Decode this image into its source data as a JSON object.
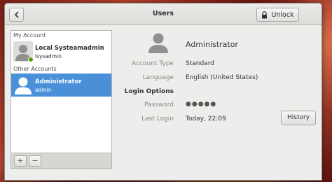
{
  "window": {
    "title": "Users"
  },
  "header": {
    "back_icon": "chevron-left-icon",
    "unlock_label": "Unlock",
    "unlock_icon": "lock-icon"
  },
  "sidebar": {
    "my_account_label": "My Account",
    "other_accounts_label": "Other Accounts",
    "accounts": [
      {
        "name": "Local Systeamadmin",
        "login": "lsysadmin",
        "online": true,
        "selected": false
      },
      {
        "name": "Administrator",
        "login": "admin",
        "online": false,
        "selected": true
      }
    ],
    "add_label": "+",
    "remove_label": "−"
  },
  "details": {
    "user_name": "Administrator",
    "account_type_label": "Account Type",
    "account_type_value": "Standard",
    "language_label": "Language",
    "language_value": "English (United States)",
    "login_options_label": "Login Options",
    "password_label": "Password",
    "password_value": "●●●●●",
    "last_login_label": "Last Login",
    "last_login_value": "Today, 22:09",
    "history_label": "History"
  },
  "colors": {
    "selection": "#4a90d9",
    "online": "#4e9a06",
    "window_bg": "#ededeb"
  }
}
